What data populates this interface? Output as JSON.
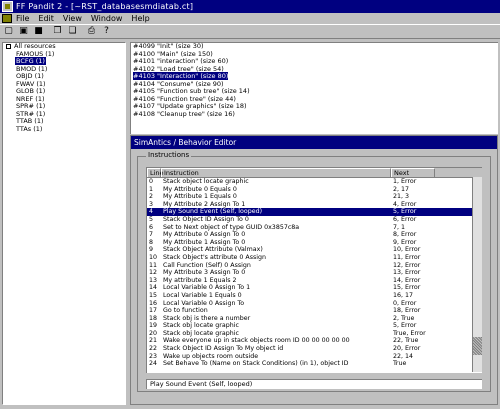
{
  "window": {
    "title": "FF Pandit 2 - [~RST_databasesmdiatab.ct]"
  },
  "menu": [
    "File",
    "Edit",
    "View",
    "Window",
    "Help"
  ],
  "toolbar": {
    "icons": [
      "new-icon",
      "open-icon",
      "save-icon",
      "copy-icon",
      "paste-icon",
      "print-icon",
      "help-icon"
    ],
    "glyphs": [
      "▢",
      "▣",
      "■",
      "❐",
      "❏",
      "⎙",
      "?"
    ]
  },
  "tree": {
    "root": "All resources",
    "items": [
      "FAMOUS (1)",
      "BCFG (1)",
      "BMOD (1)",
      "OBJD (1)",
      "FWAV (1)",
      "GLOB (1)",
      "NREF (1)",
      "SPR# (1)",
      "STR# (1)",
      "TTAB (1)",
      "TTAs (1)"
    ],
    "selected_index": 1
  },
  "resources": {
    "items": [
      "#4099 \"Init\" (size 30)",
      "#4100 \"Main\" (size 150)",
      "#4101 \"interaction\" (size 60)",
      "#4102 \"Load tree\" (size 54)",
      "#4103 \"Interaction\" (size 80)",
      "#4104 \"Consume\" (size 90)",
      "#4105 \"Function sub tree\" (size 14)",
      "#4106 \"Function tree\" (size 44)",
      "#4107 \"Update graphics\" (size 18)",
      "#4108 \"Cleanup tree\" (size 16)"
    ],
    "selected_index": 4
  },
  "editor": {
    "title": "SimAntics / Behavior Editor",
    "group_label": "Instructions",
    "columns": [
      "Line",
      "Instruction",
      "Next"
    ],
    "rows": [
      {
        "line": "0",
        "instruction": "Stack object locate graphic",
        "next": "1, Error"
      },
      {
        "line": "1",
        "instruction": "My Attribute 0 Equals 0",
        "next": "2, 17"
      },
      {
        "line": "2",
        "instruction": "My Attribute 1 Equals 0",
        "next": "21, 3"
      },
      {
        "line": "3",
        "instruction": "My Attribute 2 Assign To 1",
        "next": "4, Error"
      },
      {
        "line": "4",
        "instruction": "Play Sound Event (Self, looped)",
        "next": "5, Error"
      },
      {
        "line": "5",
        "instruction": "Stack Object ID Assign To 0",
        "next": "6, Error"
      },
      {
        "line": "6",
        "instruction": "Set to Next object of type GUID 0x3857c8a",
        "next": "7, 1"
      },
      {
        "line": "7",
        "instruction": "My Attribute 0 Assign To 0",
        "next": "8, Error"
      },
      {
        "line": "8",
        "instruction": "My Attribute 1 Assign To 0",
        "next": "9, Error"
      },
      {
        "line": "9",
        "instruction": "Stack Object Attribute (Valmax)",
        "next": "10, Error"
      },
      {
        "line": "10",
        "instruction": "Stack Object's attribute 0 Assign",
        "next": "11, Error"
      },
      {
        "line": "11",
        "instruction": "Call Function (Self) 0 Assign",
        "next": "12, Error"
      },
      {
        "line": "12",
        "instruction": "My Attribute 3 Assign To 0",
        "next": "13, Error"
      },
      {
        "line": "13",
        "instruction": "My attribute 1 Equals 2",
        "next": "14, Error"
      },
      {
        "line": "14",
        "instruction": "Local Variable 0 Assign To 1",
        "next": "15, Error"
      },
      {
        "line": "15",
        "instruction": "Local Variable 1 Equals 0",
        "next": "16, 17"
      },
      {
        "line": "16",
        "instruction": "Local Variable 0 Assign To",
        "next": "0, Error"
      },
      {
        "line": "17",
        "instruction": "Go to function",
        "next": "18, Error"
      },
      {
        "line": "18",
        "instruction": "Stack obj is there a number",
        "next": "2, True"
      },
      {
        "line": "19",
        "instruction": "Stack obj locate graphic",
        "next": "5, Error"
      },
      {
        "line": "20",
        "instruction": "Stack obj locate graphic",
        "next": "True, Error"
      },
      {
        "line": "21",
        "instruction": "Wake everyone up in stack objects room ID 00 00 00 00 00",
        "next": "22, True"
      },
      {
        "line": "22",
        "instruction": "Stack Object ID Assign To My object id",
        "next": "20, Error"
      },
      {
        "line": "23",
        "instruction": "Wake up objects room outside",
        "next": "22, 14"
      },
      {
        "line": "24",
        "instruction": "Set Behave To (Name on Stack Conditions) (in 1), object ID",
        "next": "True"
      }
    ],
    "selected_index": 4,
    "status": "Play Sound Event (Self, looped)"
  }
}
